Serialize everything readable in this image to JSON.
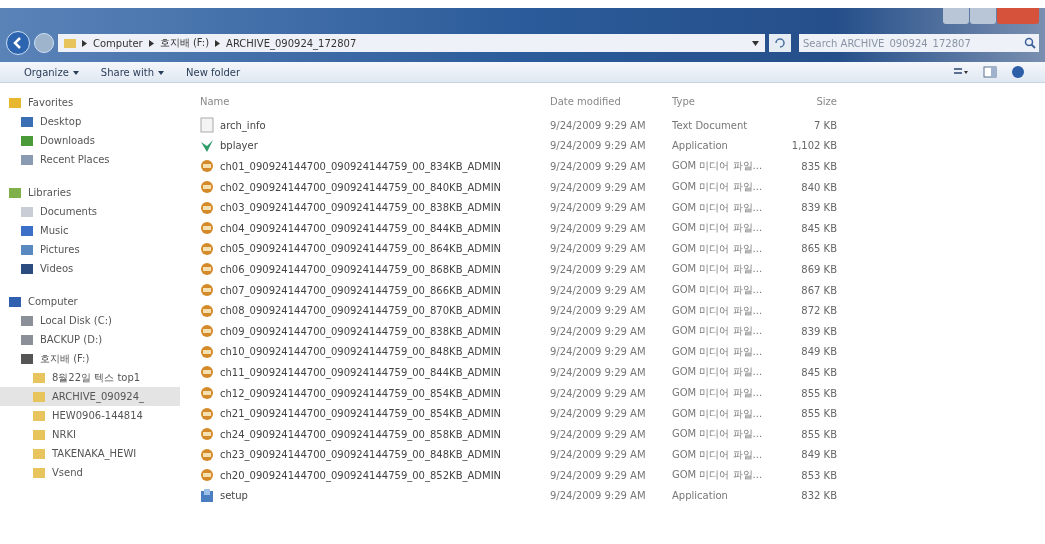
{
  "address": {
    "crumbs": [
      "Computer",
      "호지배 (F:)",
      "ARCHIVE_090924_172807"
    ]
  },
  "search": {
    "placeholder": "Search ARCHIVE_090924_172807"
  },
  "toolbar": [
    {
      "label": "Organize",
      "dropdown": true
    },
    {
      "label": "Share with",
      "dropdown": true
    },
    {
      "label": "New folder",
      "dropdown": false
    }
  ],
  "sidebar": [
    {
      "label": "Favorites",
      "kind": "favorites",
      "selected": false,
      "children": [
        {
          "label": "Desktop",
          "kind": "desktop",
          "selected": false
        },
        {
          "label": "Downloads",
          "kind": "downloads",
          "selected": false
        },
        {
          "label": "Recent Places",
          "kind": "recent",
          "selected": false
        }
      ]
    },
    {
      "label": "Libraries",
      "kind": "libraries",
      "selected": false,
      "children": [
        {
          "label": "Documents",
          "kind": "documents",
          "selected": false
        },
        {
          "label": "Music",
          "kind": "music",
          "selected": false
        },
        {
          "label": "Pictures",
          "kind": "pictures",
          "selected": false
        },
        {
          "label": "Videos",
          "kind": "videos",
          "selected": false
        }
      ]
    },
    {
      "label": "Computer",
      "kind": "computer",
      "selected": false,
      "children": [
        {
          "label": "Local Disk (C:)",
          "kind": "disk",
          "selected": false
        },
        {
          "label": "BACKUP (D:)",
          "kind": "disk",
          "selected": false
        },
        {
          "label": "호지배 (F:)",
          "kind": "drive",
          "selected": false,
          "children": [
            {
              "label": "8월22일 텍스 top1",
              "kind": "folder",
              "selected": false
            },
            {
              "label": "ARCHIVE_090924_",
              "kind": "folder",
              "selected": true
            },
            {
              "label": "HEW0906-144814",
              "kind": "folder",
              "selected": false
            },
            {
              "label": "NRKI",
              "kind": "folder",
              "selected": false
            },
            {
              "label": "TAKENAKA_HEWI",
              "kind": "folder",
              "selected": false
            },
            {
              "label": "Vsend",
              "kind": "folder",
              "selected": false
            }
          ]
        }
      ]
    }
  ],
  "table": {
    "columns": [
      "Name",
      "Date modified",
      "Type",
      "Size"
    ],
    "rows": [
      {
        "name": "arch_info",
        "kind": "text",
        "date": "9/24/2009 9:29 AM",
        "type": "Text Document",
        "size": "7 KB"
      },
      {
        "name": "bplayer",
        "kind": "app",
        "date": "9/24/2009 9:29 AM",
        "type": "Application",
        "size": "1,102 KB"
      },
      {
        "name": "ch01_090924144700_090924144759_00_834KB_ADMIN",
        "kind": "media",
        "date": "9/24/2009 9:29 AM",
        "type": "GOM 미디어 파일...",
        "size": "835 KB"
      },
      {
        "name": "ch02_090924144700_090924144759_00_840KB_ADMIN",
        "kind": "media",
        "date": "9/24/2009 9:29 AM",
        "type": "GOM 미디어 파일...",
        "size": "840 KB"
      },
      {
        "name": "ch03_090924144700_090924144759_00_838KB_ADMIN",
        "kind": "media",
        "date": "9/24/2009 9:29 AM",
        "type": "GOM 미디어 파일...",
        "size": "839 KB"
      },
      {
        "name": "ch04_090924144700_090924144759_00_844KB_ADMIN",
        "kind": "media",
        "date": "9/24/2009 9:29 AM",
        "type": "GOM 미디어 파일...",
        "size": "845 KB"
      },
      {
        "name": "ch05_090924144700_090924144759_00_864KB_ADMIN",
        "kind": "media",
        "date": "9/24/2009 9:29 AM",
        "type": "GOM 미디어 파일...",
        "size": "865 KB"
      },
      {
        "name": "ch06_090924144700_090924144759_00_868KB_ADMIN",
        "kind": "media",
        "date": "9/24/2009 9:29 AM",
        "type": "GOM 미디어 파일...",
        "size": "869 KB"
      },
      {
        "name": "ch07_090924144700_090924144759_00_866KB_ADMIN",
        "kind": "media",
        "date": "9/24/2009 9:29 AM",
        "type": "GOM 미디어 파일...",
        "size": "867 KB"
      },
      {
        "name": "ch08_090924144700_090924144759_00_870KB_ADMIN",
        "kind": "media",
        "date": "9/24/2009 9:29 AM",
        "type": "GOM 미디어 파일...",
        "size": "872 KB"
      },
      {
        "name": "ch09_090924144700_090924144759_00_838KB_ADMIN",
        "kind": "media",
        "date": "9/24/2009 9:29 AM",
        "type": "GOM 미디어 파일...",
        "size": "839 KB"
      },
      {
        "name": "ch10_090924144700_090924144759_00_848KB_ADMIN",
        "kind": "media",
        "date": "9/24/2009 9:29 AM",
        "type": "GOM 미디어 파일...",
        "size": "849 KB"
      },
      {
        "name": "ch11_090924144700_090924144759_00_844KB_ADMIN",
        "kind": "media",
        "date": "9/24/2009 9:29 AM",
        "type": "GOM 미디어 파일...",
        "size": "845 KB"
      },
      {
        "name": "ch12_090924144700_090924144759_00_854KB_ADMIN",
        "kind": "media",
        "date": "9/24/2009 9:29 AM",
        "type": "GOM 미디어 파일...",
        "size": "855 KB"
      },
      {
        "name": "ch21_090924144700_090924144759_00_854KB_ADMIN",
        "kind": "media",
        "date": "9/24/2009 9:29 AM",
        "type": "GOM 미디어 파일...",
        "size": "855 KB"
      },
      {
        "name": "ch24_090924144700_090924144759_00_858KB_ADMIN",
        "kind": "media",
        "date": "9/24/2009 9:29 AM",
        "type": "GOM 미디어 파일...",
        "size": "855 KB"
      },
      {
        "name": "ch23_090924144700_090924144759_00_848KB_ADMIN",
        "kind": "media",
        "date": "9/24/2009 9:29 AM",
        "type": "GOM 미디어 파일...",
        "size": "849 KB"
      },
      {
        "name": "ch20_090924144700_090924144759_00_852KB_ADMIN",
        "kind": "media",
        "date": "9/24/2009 9:29 AM",
        "type": "GOM 미디어 파일...",
        "size": "853 KB"
      },
      {
        "name": "setup",
        "kind": "installer",
        "date": "9/24/2009 9:29 AM",
        "type": "Application",
        "size": "832 KB"
      }
    ]
  }
}
